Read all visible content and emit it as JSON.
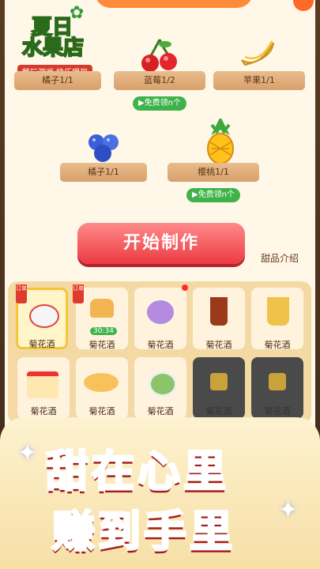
{
  "logo": {
    "title_line1": "夏日",
    "title_line2": "水果店",
    "subtitle": "畅玩游戏  快乐提现"
  },
  "fruits": [
    {
      "label": "橘子1/1",
      "icon": "orange-icon"
    },
    {
      "label": "蓝莓1/2",
      "icon": "cherry-icon"
    },
    {
      "label": "苹果1/1",
      "icon": "banana-icon"
    },
    {
      "label": "橘子1/1",
      "icon": "blueberry-icon"
    },
    {
      "label": "樱桃1/1",
      "icon": "pineapple-icon"
    }
  ],
  "free_buttons": [
    "免费领n个",
    "免费领n个"
  ],
  "start_button": "开始制作",
  "dessert_intro": "甜品介绍",
  "order_tag": "订单",
  "timer": "30:34",
  "desserts_row1": [
    "菊花酒",
    "菊花酒",
    "菊花酒",
    "菊花酒",
    "菊花酒"
  ],
  "desserts_row2": [
    "菊花酒",
    "菊花酒",
    "菊花酒",
    "菊花酒",
    "菊花酒"
  ],
  "slogan1": "甜在心里",
  "slogan2": "赚到手里",
  "colors": {
    "accent_red": "#ec3b42",
    "green": "#3fb34a",
    "shelf": "#d7a06b"
  }
}
